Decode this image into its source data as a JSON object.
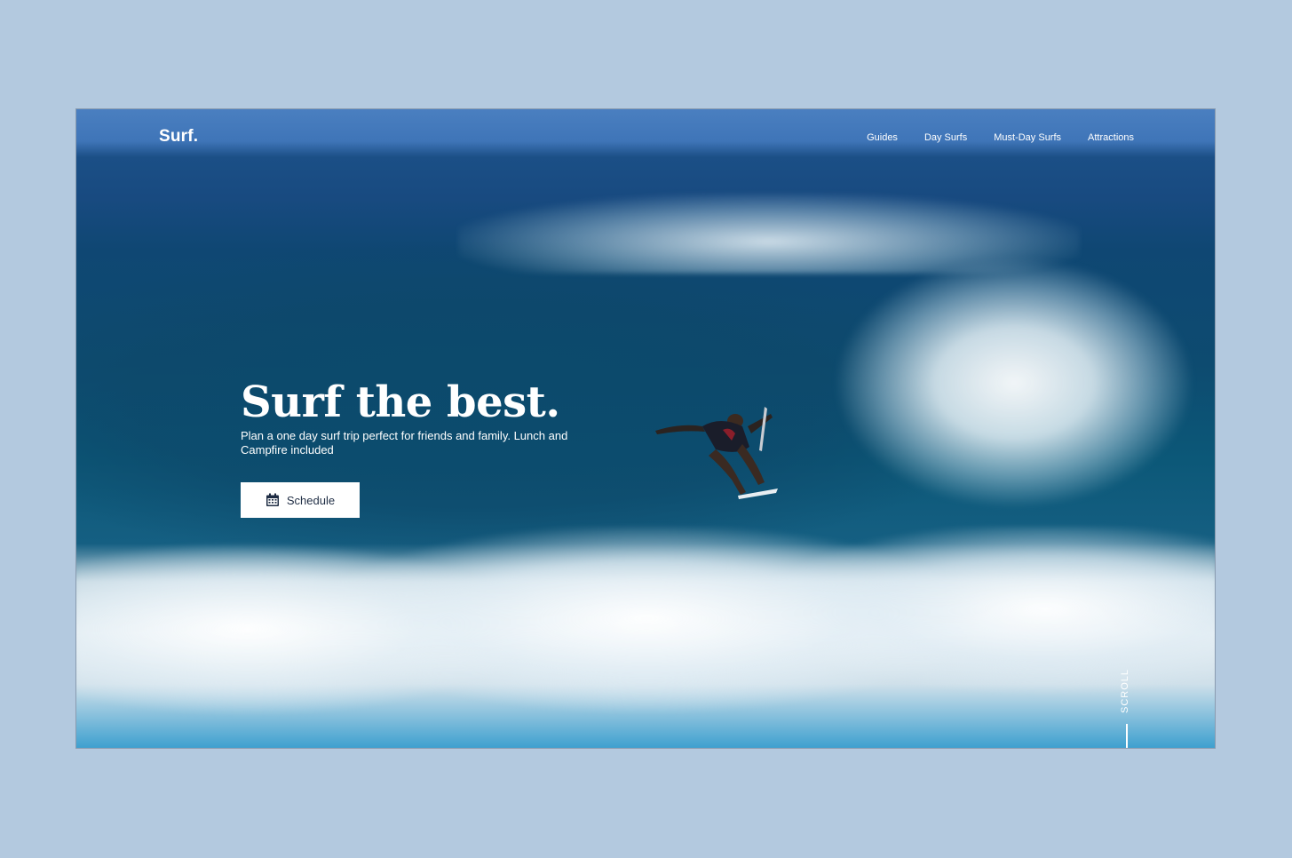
{
  "brand": {
    "logo": "Surf."
  },
  "nav": {
    "items": [
      {
        "label": "Guides"
      },
      {
        "label": "Day Surfs"
      },
      {
        "label": "Must-Day Surfs"
      },
      {
        "label": "Attractions"
      }
    ]
  },
  "hero": {
    "title": "Surf the best.",
    "subtitle": "Plan a one day surf trip perfect for friends and family. Lunch and Campfire included",
    "cta": {
      "label": "Schedule",
      "icon": "calendar-icon"
    },
    "scroll_label": "SCROLL"
  },
  "colors": {
    "page_background": "#b3c9df",
    "button_text": "#1f2d44",
    "text": "#ffffff"
  }
}
